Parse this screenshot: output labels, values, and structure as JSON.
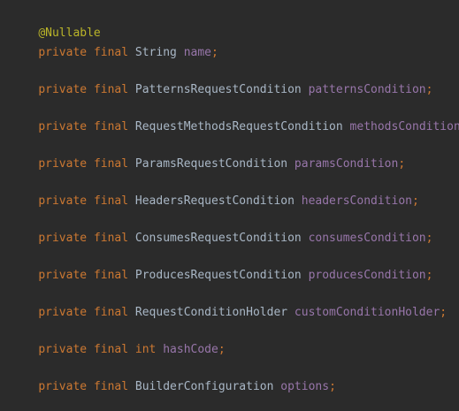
{
  "annotation": "@Nullable",
  "lines": [
    {
      "mods": [
        "private",
        "final"
      ],
      "type": "String",
      "field": "name"
    },
    {
      "mods": [
        "private",
        "final"
      ],
      "type": "PatternsRequestCondition",
      "field": "patternsCondition"
    },
    {
      "mods": [
        "private",
        "final"
      ],
      "type": "RequestMethodsRequestCondition",
      "field": "methodsCondition"
    },
    {
      "mods": [
        "private",
        "final"
      ],
      "type": "ParamsRequestCondition",
      "field": "paramsCondition"
    },
    {
      "mods": [
        "private",
        "final"
      ],
      "type": "HeadersRequestCondition",
      "field": "headersCondition"
    },
    {
      "mods": [
        "private",
        "final"
      ],
      "type": "ConsumesRequestCondition",
      "field": "consumesCondition"
    },
    {
      "mods": [
        "private",
        "final"
      ],
      "type": "ProducesRequestCondition",
      "field": "producesCondition"
    },
    {
      "mods": [
        "private",
        "final"
      ],
      "type": "RequestConditionHolder",
      "field": "customConditionHolder"
    },
    {
      "mods": [
        "private",
        "final"
      ],
      "keyword_type": "int",
      "field": "hashCode"
    },
    {
      "mods": [
        "private",
        "final"
      ],
      "type": "BuilderConfiguration",
      "field": "options"
    }
  ],
  "semicolon": ";",
  "colors": {
    "background": "#2b2b2b",
    "keyword": "#cc7832",
    "annotation": "#bbb529",
    "type": "#a9b7c6",
    "field": "#9876aa"
  }
}
